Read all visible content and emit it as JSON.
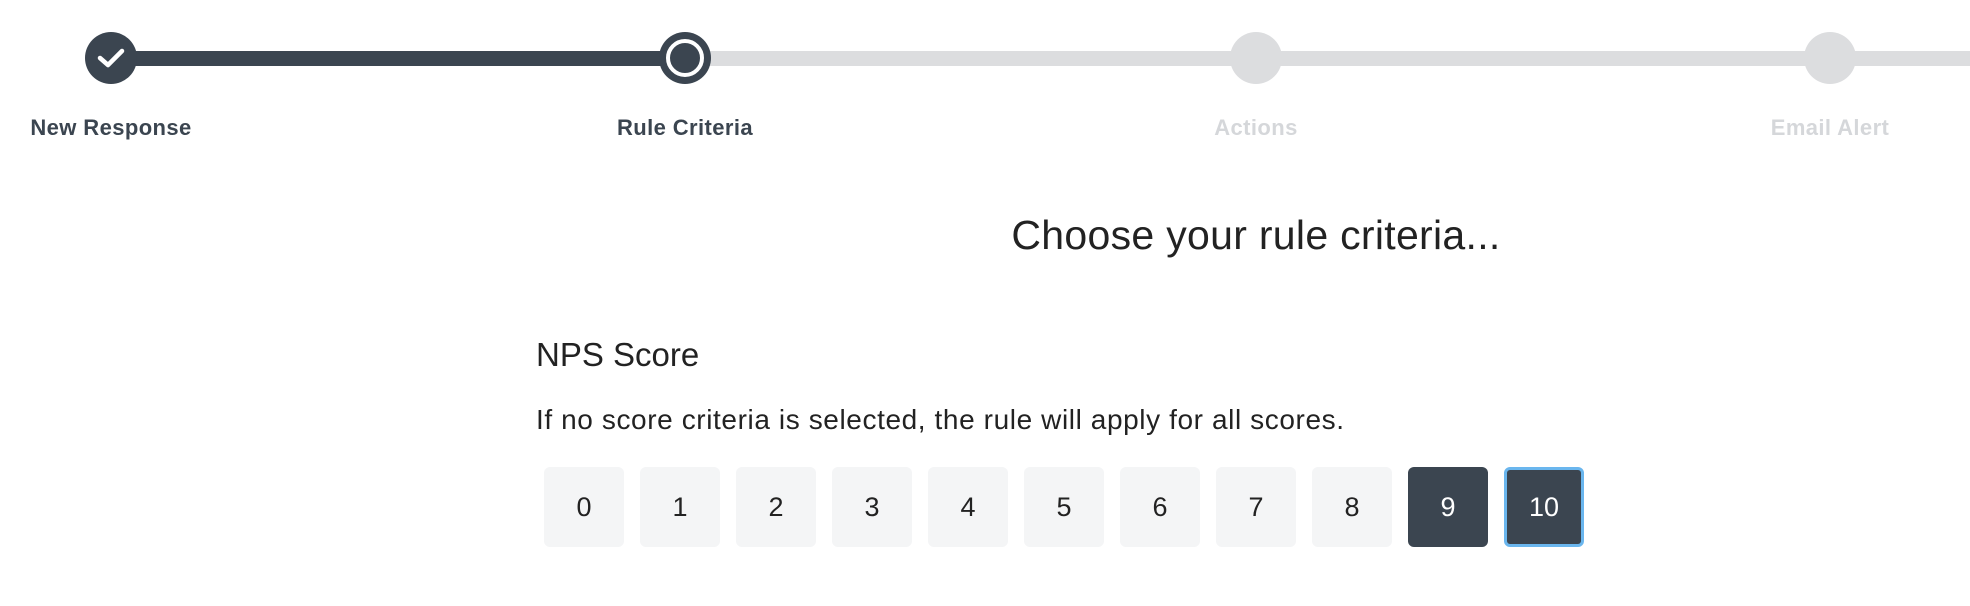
{
  "stepper": {
    "steps": [
      {
        "label": "New Response",
        "state": "done"
      },
      {
        "label": "Rule Criteria",
        "state": "current"
      },
      {
        "label": "Actions",
        "state": "pending"
      },
      {
        "label": "Email Alert",
        "state": "pending"
      }
    ],
    "done_icon": "check-icon"
  },
  "main": {
    "heading": "Choose your rule criteria...",
    "nps_title": "NPS Score",
    "nps_hint": "If no score criteria is selected, the rule will apply for all scores.",
    "scores": [
      {
        "label": "0",
        "selected": false
      },
      {
        "label": "1",
        "selected": false
      },
      {
        "label": "2",
        "selected": false
      },
      {
        "label": "3",
        "selected": false
      },
      {
        "label": "4",
        "selected": false
      },
      {
        "label": "5",
        "selected": false
      },
      {
        "label": "6",
        "selected": false
      },
      {
        "label": "7",
        "selected": false
      },
      {
        "label": "8",
        "selected": false
      },
      {
        "label": "9",
        "selected": true
      },
      {
        "label": "10",
        "selected": true,
        "focused": true
      }
    ]
  },
  "colors": {
    "accent_dark": "#3b4550",
    "inactive": "#dcdddf",
    "focus_ring": "#6ab6ee",
    "score_bg": "#f4f5f6"
  }
}
